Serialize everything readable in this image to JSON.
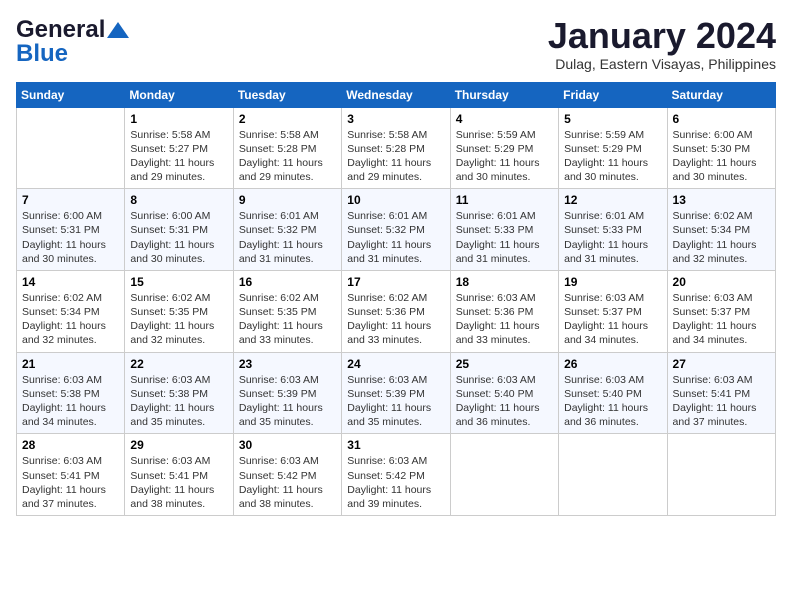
{
  "logo": {
    "line1": "General",
    "line2": "Blue"
  },
  "header": {
    "month": "January 2024",
    "location": "Dulag, Eastern Visayas, Philippines"
  },
  "weekdays": [
    "Sunday",
    "Monday",
    "Tuesday",
    "Wednesday",
    "Thursday",
    "Friday",
    "Saturday"
  ],
  "weeks": [
    [
      {
        "day": "",
        "info": ""
      },
      {
        "day": "1",
        "info": "Sunrise: 5:58 AM\nSunset: 5:27 PM\nDaylight: 11 hours\nand 29 minutes."
      },
      {
        "day": "2",
        "info": "Sunrise: 5:58 AM\nSunset: 5:28 PM\nDaylight: 11 hours\nand 29 minutes."
      },
      {
        "day": "3",
        "info": "Sunrise: 5:58 AM\nSunset: 5:28 PM\nDaylight: 11 hours\nand 29 minutes."
      },
      {
        "day": "4",
        "info": "Sunrise: 5:59 AM\nSunset: 5:29 PM\nDaylight: 11 hours\nand 30 minutes."
      },
      {
        "day": "5",
        "info": "Sunrise: 5:59 AM\nSunset: 5:29 PM\nDaylight: 11 hours\nand 30 minutes."
      },
      {
        "day": "6",
        "info": "Sunrise: 6:00 AM\nSunset: 5:30 PM\nDaylight: 11 hours\nand 30 minutes."
      }
    ],
    [
      {
        "day": "7",
        "info": "Sunrise: 6:00 AM\nSunset: 5:31 PM\nDaylight: 11 hours\nand 30 minutes."
      },
      {
        "day": "8",
        "info": "Sunrise: 6:00 AM\nSunset: 5:31 PM\nDaylight: 11 hours\nand 30 minutes."
      },
      {
        "day": "9",
        "info": "Sunrise: 6:01 AM\nSunset: 5:32 PM\nDaylight: 11 hours\nand 31 minutes."
      },
      {
        "day": "10",
        "info": "Sunrise: 6:01 AM\nSunset: 5:32 PM\nDaylight: 11 hours\nand 31 minutes."
      },
      {
        "day": "11",
        "info": "Sunrise: 6:01 AM\nSunset: 5:33 PM\nDaylight: 11 hours\nand 31 minutes."
      },
      {
        "day": "12",
        "info": "Sunrise: 6:01 AM\nSunset: 5:33 PM\nDaylight: 11 hours\nand 31 minutes."
      },
      {
        "day": "13",
        "info": "Sunrise: 6:02 AM\nSunset: 5:34 PM\nDaylight: 11 hours\nand 32 minutes."
      }
    ],
    [
      {
        "day": "14",
        "info": "Sunrise: 6:02 AM\nSunset: 5:34 PM\nDaylight: 11 hours\nand 32 minutes."
      },
      {
        "day": "15",
        "info": "Sunrise: 6:02 AM\nSunset: 5:35 PM\nDaylight: 11 hours\nand 32 minutes."
      },
      {
        "day": "16",
        "info": "Sunrise: 6:02 AM\nSunset: 5:35 PM\nDaylight: 11 hours\nand 33 minutes."
      },
      {
        "day": "17",
        "info": "Sunrise: 6:02 AM\nSunset: 5:36 PM\nDaylight: 11 hours\nand 33 minutes."
      },
      {
        "day": "18",
        "info": "Sunrise: 6:03 AM\nSunset: 5:36 PM\nDaylight: 11 hours\nand 33 minutes."
      },
      {
        "day": "19",
        "info": "Sunrise: 6:03 AM\nSunset: 5:37 PM\nDaylight: 11 hours\nand 34 minutes."
      },
      {
        "day": "20",
        "info": "Sunrise: 6:03 AM\nSunset: 5:37 PM\nDaylight: 11 hours\nand 34 minutes."
      }
    ],
    [
      {
        "day": "21",
        "info": "Sunrise: 6:03 AM\nSunset: 5:38 PM\nDaylight: 11 hours\nand 34 minutes."
      },
      {
        "day": "22",
        "info": "Sunrise: 6:03 AM\nSunset: 5:38 PM\nDaylight: 11 hours\nand 35 minutes."
      },
      {
        "day": "23",
        "info": "Sunrise: 6:03 AM\nSunset: 5:39 PM\nDaylight: 11 hours\nand 35 minutes."
      },
      {
        "day": "24",
        "info": "Sunrise: 6:03 AM\nSunset: 5:39 PM\nDaylight: 11 hours\nand 35 minutes."
      },
      {
        "day": "25",
        "info": "Sunrise: 6:03 AM\nSunset: 5:40 PM\nDaylight: 11 hours\nand 36 minutes."
      },
      {
        "day": "26",
        "info": "Sunrise: 6:03 AM\nSunset: 5:40 PM\nDaylight: 11 hours\nand 36 minutes."
      },
      {
        "day": "27",
        "info": "Sunrise: 6:03 AM\nSunset: 5:41 PM\nDaylight: 11 hours\nand 37 minutes."
      }
    ],
    [
      {
        "day": "28",
        "info": "Sunrise: 6:03 AM\nSunset: 5:41 PM\nDaylight: 11 hours\nand 37 minutes."
      },
      {
        "day": "29",
        "info": "Sunrise: 6:03 AM\nSunset: 5:41 PM\nDaylight: 11 hours\nand 38 minutes."
      },
      {
        "day": "30",
        "info": "Sunrise: 6:03 AM\nSunset: 5:42 PM\nDaylight: 11 hours\nand 38 minutes."
      },
      {
        "day": "31",
        "info": "Sunrise: 6:03 AM\nSunset: 5:42 PM\nDaylight: 11 hours\nand 39 minutes."
      },
      {
        "day": "",
        "info": ""
      },
      {
        "day": "",
        "info": ""
      },
      {
        "day": "",
        "info": ""
      }
    ]
  ]
}
